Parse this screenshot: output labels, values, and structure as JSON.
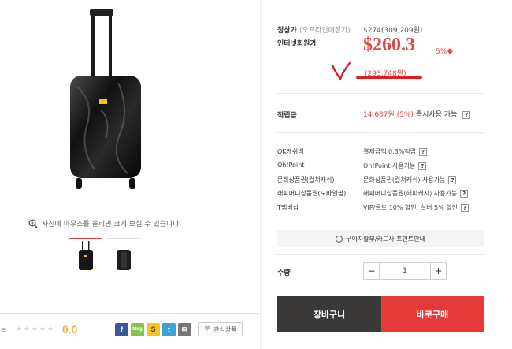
{
  "gallery": {
    "zoom_hint": "사진에 마우스를 올리면 크게 보실 수 있습니다."
  },
  "rating": {
    "prefix": "ㅌ",
    "stars_filled": 0,
    "stars_total": 5,
    "score": "0.0"
  },
  "share": {
    "facebook": "f",
    "blog": "blog",
    "story": "S",
    "twitter": "t",
    "mail": "✉",
    "wishlist_label": "관심상품"
  },
  "price": {
    "regular_label": "정상가",
    "regular_sub": "(오프라인매장가)",
    "regular_value": "$274(309,209원)",
    "member_label": "인터넷회원가",
    "sale_value": "$260.3",
    "discount": "5%",
    "sale_krw": "(293,748원)"
  },
  "points": {
    "label": "적립금",
    "value_red": "14,687원 (5%)",
    "value_suffix": "즉시사용 가능"
  },
  "benefits": [
    {
      "label": "OK캐쉬백",
      "value": "결제금액 0.3%적립"
    },
    {
      "label": "Oh!Point",
      "value": "Oh!Point 사용가능"
    },
    {
      "label": "문화상품권(컬쳐캐쉬)",
      "value": "문화상품권(컬쳐캐쉬) 사용가능"
    },
    {
      "label": "해피머니상품권(모바일팝)",
      "value": "해피머니상품권(해피캐시) 사용가능"
    },
    {
      "label": "T멤버십",
      "value": "VIP/골드 10% 할인, 실버 5% 할인"
    }
  ],
  "installment": {
    "label": "무이자할부/카드사 포인트안내"
  },
  "quantity": {
    "label": "수량",
    "value": "1",
    "minus": "−",
    "plus": "+"
  },
  "actions": {
    "cart": "장바구니",
    "buy": "바로구매"
  },
  "colors": {
    "accent_red": "#e43a3a",
    "price_red": "#e04848",
    "dark_button": "#3b3838",
    "score_gold": "#e8b34a"
  }
}
